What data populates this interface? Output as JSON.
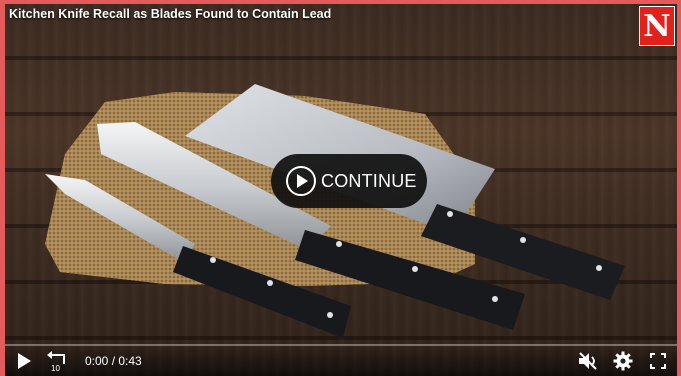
{
  "video": {
    "title": "Kitchen Knife Recall as Blades Found to Contain Lead",
    "logo_letter": "N",
    "continue_label": "CONTINUE",
    "current_time": "0:00",
    "separator": " / ",
    "duration": "0:43",
    "progress_fraction": 0,
    "rewind_seconds": "10"
  },
  "icons": {
    "play": "play-icon",
    "rewind": "rewind-10-icon",
    "mute": "volume-muted-icon",
    "settings": "gear-icon",
    "fullscreen": "fullscreen-icon"
  },
  "colors": {
    "frame": "#e35b5b",
    "logo_bg": "#e2211c"
  }
}
